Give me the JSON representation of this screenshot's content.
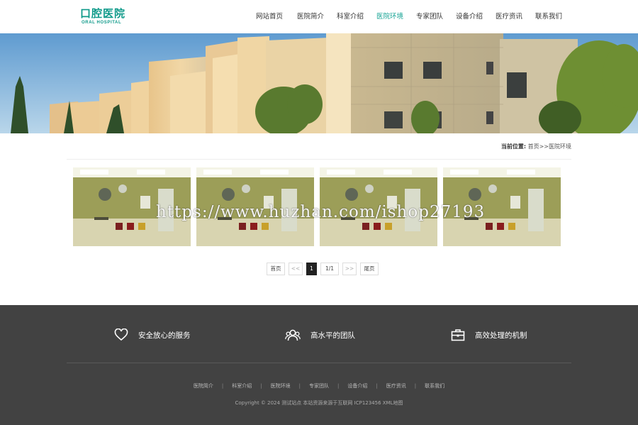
{
  "header": {
    "logo_cn": "口腔医院",
    "logo_en": "ORAL HOSPITAL",
    "nav": [
      {
        "label": "网站首页",
        "active": false
      },
      {
        "label": "医院简介",
        "active": false
      },
      {
        "label": "科室介绍",
        "active": false
      },
      {
        "label": "医院环境",
        "active": true
      },
      {
        "label": "专家团队",
        "active": false
      },
      {
        "label": "设备介绍",
        "active": false
      },
      {
        "label": "医疗资讯",
        "active": false
      },
      {
        "label": "联系我们",
        "active": false
      }
    ]
  },
  "breadcrumb": {
    "prefix": "当前位置:",
    "path": "首页>>医院环境"
  },
  "watermark": "https://www.huzhan.com/ishop27193",
  "pagination": {
    "first": "首页",
    "prev": "<<",
    "current": "1",
    "total": "1/1",
    "next": ">>",
    "last": "尾页"
  },
  "footer": {
    "features": [
      {
        "icon": "heart-icon",
        "label": "安全放心的服务"
      },
      {
        "icon": "team-icon",
        "label": "高水平的团队"
      },
      {
        "icon": "briefcase-icon",
        "label": "高效处理的机制"
      }
    ],
    "links": [
      "医院简介",
      "科室介绍",
      "医院环境",
      "专家团队",
      "设备介绍",
      "医疗资讯",
      "联系我们"
    ],
    "copyright": "Copyright © 2024 测试站点 本站资源来源于互联网 ICP123456 XML地图"
  },
  "colors": {
    "accent": "#15a394",
    "footer_bg": "#424242"
  }
}
